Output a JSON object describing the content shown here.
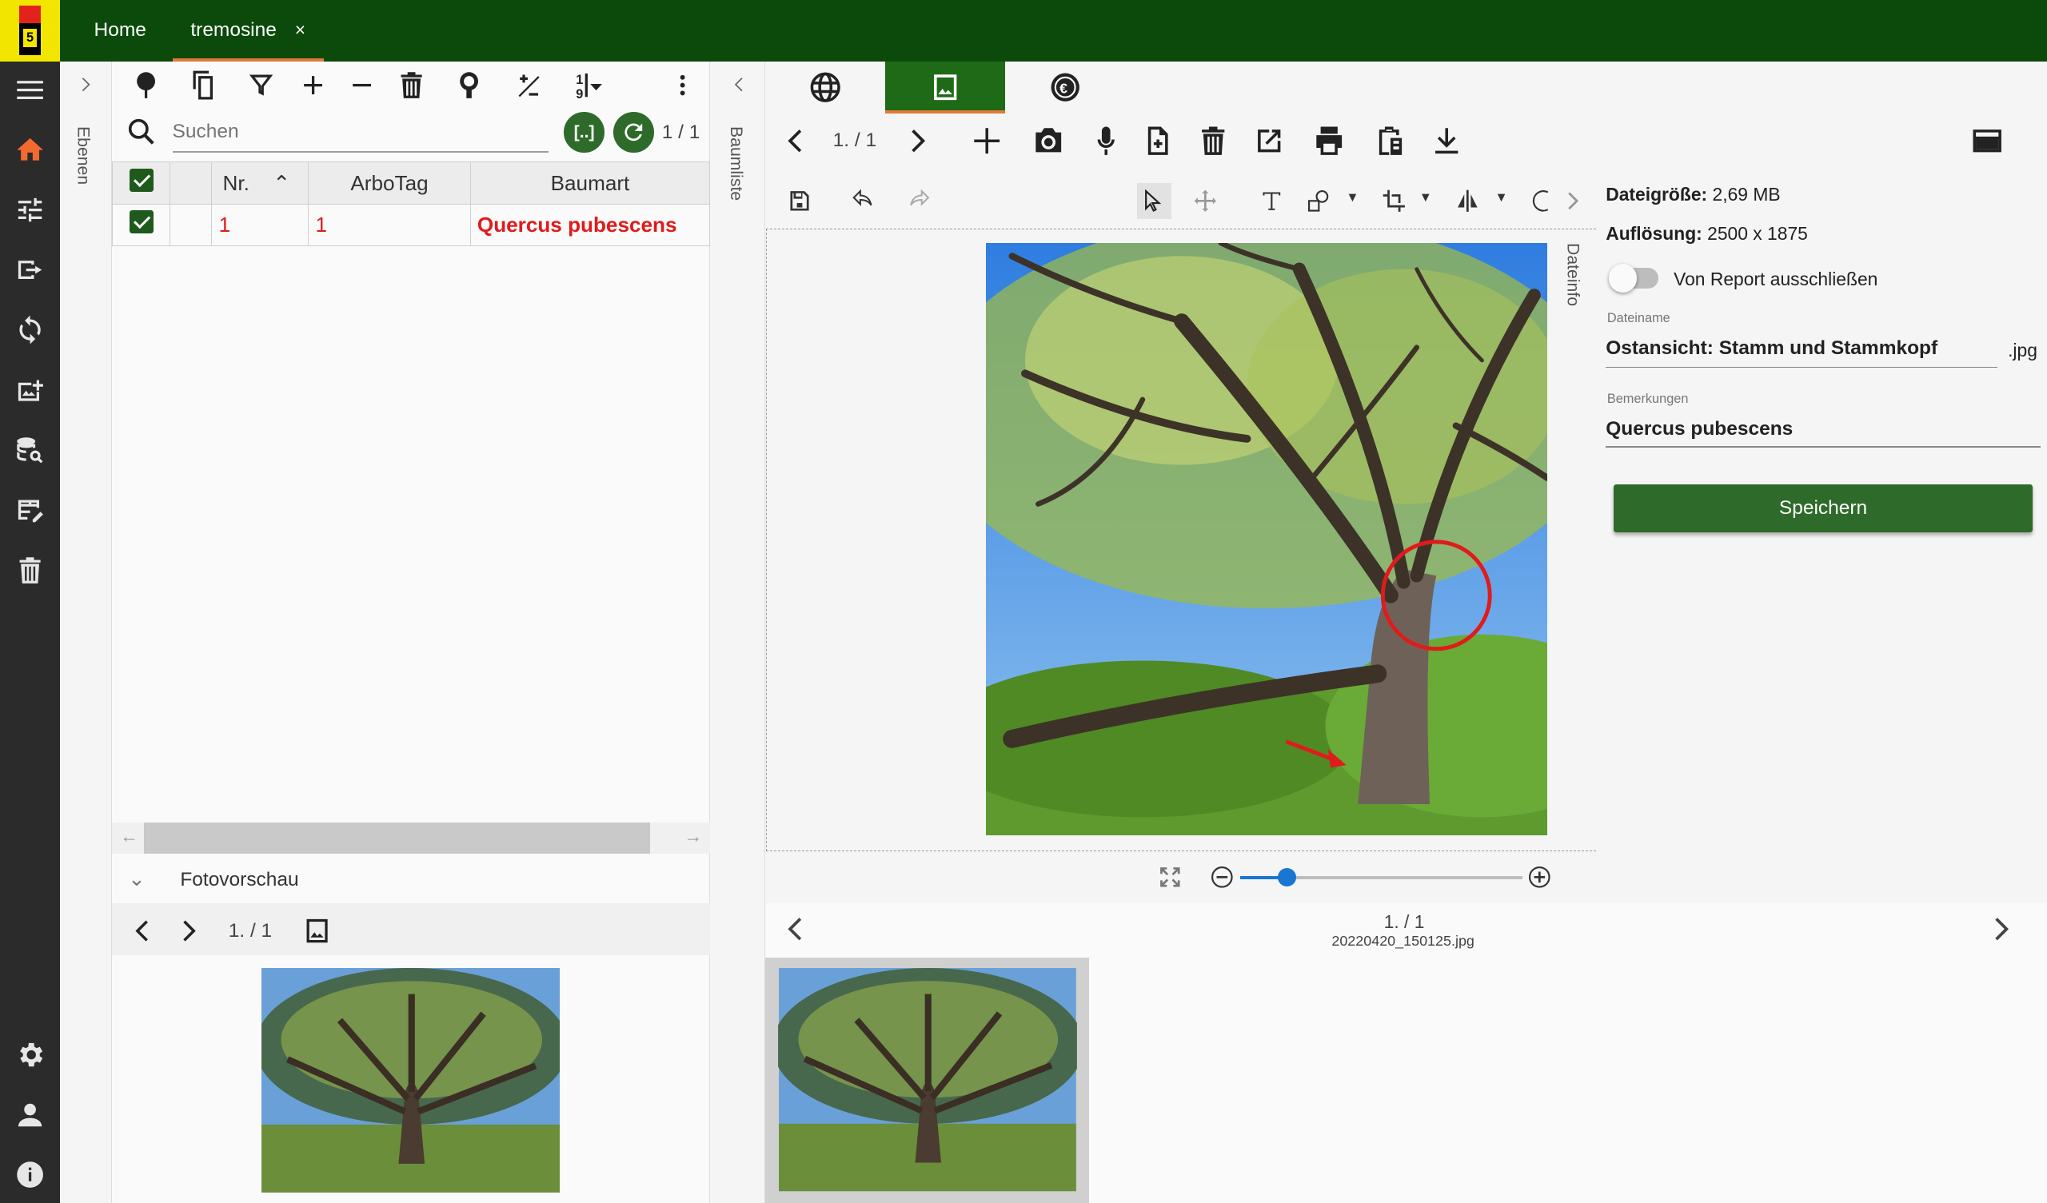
{
  "tabs": [
    {
      "label": "Home"
    },
    {
      "label": "tremosine",
      "close": "×"
    }
  ],
  "logo": {
    "digit": "5"
  },
  "side_labels": {
    "ebenen": "Ebenen",
    "baumliste": "Baumliste",
    "dateinfo": "Dateinfo"
  },
  "search": {
    "placeholder": "Suchen",
    "count": "1 / 1"
  },
  "table": {
    "columns": [
      "Nr.",
      "ArboTag",
      "Baumart"
    ],
    "rows": [
      {
        "nr": "1",
        "arbotag": "1",
        "baumart": "Quercus pubescens"
      }
    ]
  },
  "preview": {
    "title": "Fotovorschau",
    "page": "1. / 1"
  },
  "viewer": {
    "page": "1. / 1"
  },
  "fileinfo": {
    "size_label": "Dateigröße:",
    "size_value": "2,69 MB",
    "res_label": "Auflösung:",
    "res_value": "2500 x 1875",
    "exclude_label": "Von Report ausschließen",
    "exclude_on": false,
    "filename_label": "Dateiname",
    "filename_value": "Ostansicht: Stamm und Stammkopf",
    "extension": ".jpg",
    "remarks_label": "Bemerkungen",
    "remarks_value": "Quercus pubescens",
    "save_label": "Speichern"
  },
  "zoom": {
    "level_fraction": 0.17
  },
  "gallery": {
    "page": "1. / 1",
    "filename": "20220420_150125.jpg"
  },
  "colors": {
    "topbar": "#0b4a0a",
    "accent_green": "#2e6b2a",
    "tab_underline": "#e07a3a",
    "highlight_red": "#e01b1b"
  }
}
